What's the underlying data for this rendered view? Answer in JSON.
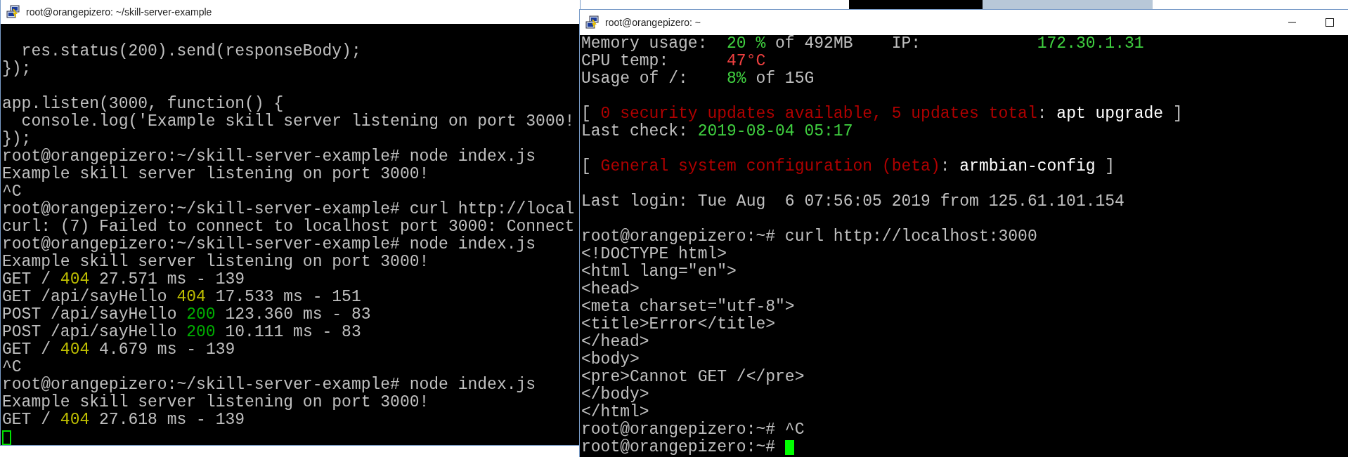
{
  "windows": [
    {
      "title": "root@orangepizero: ~/skill-server-example",
      "cursor": {
        "kind": "outline"
      },
      "lines": [
        {
          "segments": [
            {
              "text": "  res.status(200).send(responseBody);"
            }
          ]
        },
        {
          "segments": [
            {
              "text": "});"
            }
          ]
        },
        {
          "blank_before": true,
          "segments": [
            {
              "text": "app.listen(3000, function() {"
            }
          ]
        },
        {
          "segments": [
            {
              "text": "  console.log('Example skill server listening on port 3000!"
            }
          ]
        },
        {
          "segments": [
            {
              "text": "});"
            }
          ]
        },
        {
          "segments": [
            {
              "text": "root@orangepizero:~/skill-server-example# node index.js"
            }
          ]
        },
        {
          "segments": [
            {
              "text": "Example skill server listening on port 3000!"
            }
          ]
        },
        {
          "segments": [
            {
              "text": "^C"
            }
          ]
        },
        {
          "segments": [
            {
              "text": "root@orangepizero:~/skill-server-example# curl http://local"
            }
          ]
        },
        {
          "segments": [
            {
              "text": "curl: (7) Failed to connect to localhost port 3000: Connect"
            }
          ]
        },
        {
          "segments": [
            {
              "text": "root@orangepizero:~/skill-server-example# node index.js"
            }
          ]
        },
        {
          "segments": [
            {
              "text": "Example skill server listening on port 3000!"
            }
          ]
        },
        {
          "segments": [
            {
              "text": "GET / "
            },
            {
              "text": "404",
              "color": "#c0c000"
            },
            {
              "text": " 27.571 ms - 139"
            }
          ]
        },
        {
          "segments": [
            {
              "text": "GET /api/sayHello "
            },
            {
              "text": "404",
              "color": "#c0c000"
            },
            {
              "text": " 17.533 ms - 151"
            }
          ]
        },
        {
          "segments": [
            {
              "text": "POST /api/sayHello "
            },
            {
              "text": "200",
              "color": "#00b000"
            },
            {
              "text": " 123.360 ms - 83"
            }
          ]
        },
        {
          "segments": [
            {
              "text": "POST /api/sayHello "
            },
            {
              "text": "200",
              "color": "#00b000"
            },
            {
              "text": " 10.111 ms - 83"
            }
          ]
        },
        {
          "segments": [
            {
              "text": "GET / "
            },
            {
              "text": "404",
              "color": "#c0c000"
            },
            {
              "text": " 4.679 ms - 139"
            }
          ]
        },
        {
          "segments": [
            {
              "text": "^C"
            }
          ]
        },
        {
          "segments": [
            {
              "text": "root@orangepizero:~/skill-server-example# node index.js"
            }
          ]
        },
        {
          "segments": [
            {
              "text": "Example skill server listening on port 3000!"
            }
          ]
        },
        {
          "segments": [
            {
              "text": "GET / "
            },
            {
              "text": "404",
              "color": "#c0c000"
            },
            {
              "text": " 27.618 ms - 139"
            }
          ]
        }
      ]
    },
    {
      "title": "root@orangepizero: ~",
      "controls": [
        {
          "kind": "minimize"
        },
        {
          "kind": "maximize"
        }
      ],
      "cursor": {
        "kind": "block"
      },
      "lines": [
        {
          "segments": [
            {
              "text": "Memory usage:  "
            },
            {
              "text": "20 %",
              "color": "#40d040"
            },
            {
              "text": " of 492MB    IP:            "
            },
            {
              "text": "172.30.1.31",
              "color": "#40d040"
            }
          ]
        },
        {
          "segments": [
            {
              "text": "CPU temp:      "
            },
            {
              "text": "47°C",
              "color": "#f04040"
            }
          ]
        },
        {
          "segments": [
            {
              "text": "Usage of /:    "
            },
            {
              "text": "8%",
              "color": "#40d040"
            },
            {
              "text": " of 15G"
            }
          ]
        },
        {
          "blank_before": true,
          "segments": [
            {
              "text": "[ "
            },
            {
              "text": "0 security updates available, 5 updates total",
              "color": "#b00000"
            },
            {
              "text": ": "
            },
            {
              "text": "apt upgrade",
              "color": "#ffffff"
            },
            {
              "text": " ]"
            }
          ]
        },
        {
          "segments": [
            {
              "text": "Last check: "
            },
            {
              "text": "2019-08-04 05:17",
              "color": "#40d040"
            }
          ]
        },
        {
          "blank_before": true,
          "segments": [
            {
              "text": "[ "
            },
            {
              "text": "General system configuration (beta)",
              "color": "#b00000"
            },
            {
              "text": ": "
            },
            {
              "text": "armbian-config",
              "color": "#ffffff"
            },
            {
              "text": " ]"
            }
          ]
        },
        {
          "blank_before": true,
          "segments": [
            {
              "text": "Last login: Tue Aug  6 07:56:05 2019 from 125.61.101.154"
            }
          ]
        },
        {
          "blank_before": true,
          "segments": [
            {
              "text": "root@orangepizero:~# curl http://localhost:3000"
            }
          ]
        },
        {
          "segments": [
            {
              "text": "<!DOCTYPE html>"
            }
          ]
        },
        {
          "segments": [
            {
              "text": "<html lang=\"en\">"
            }
          ]
        },
        {
          "segments": [
            {
              "text": "<head>"
            }
          ]
        },
        {
          "segments": [
            {
              "text": "<meta charset=\"utf-8\">"
            }
          ]
        },
        {
          "segments": [
            {
              "text": "<title>Error</title>"
            }
          ]
        },
        {
          "segments": [
            {
              "text": "</head>"
            }
          ]
        },
        {
          "segments": [
            {
              "text": "<body>"
            }
          ]
        },
        {
          "segments": [
            {
              "text": "<pre>Cannot GET /</pre>"
            }
          ]
        },
        {
          "segments": [
            {
              "text": "</body>"
            }
          ]
        },
        {
          "segments": [
            {
              "text": "</html>"
            }
          ]
        },
        {
          "segments": [
            {
              "text": "root@orangepizero:~# ^C"
            }
          ]
        },
        {
          "segments": [
            {
              "text": "root@orangepizero:~# "
            }
          ]
        }
      ]
    }
  ]
}
